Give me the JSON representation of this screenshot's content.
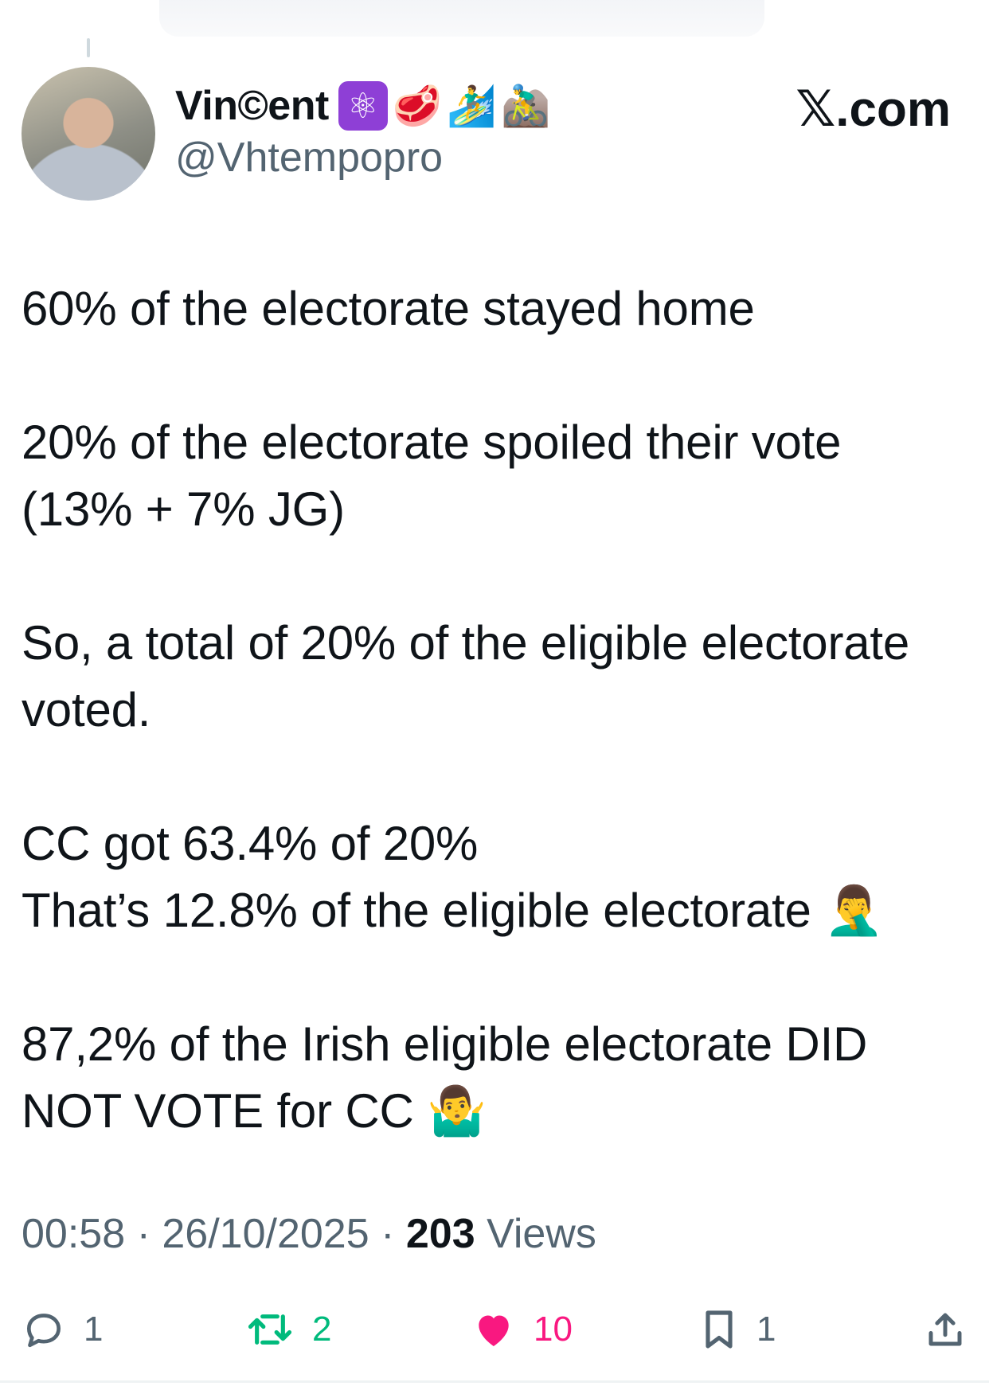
{
  "author": {
    "display_name": "Vin©ent",
    "emojis": [
      "⚛️",
      "🥩",
      "🏄‍♂️",
      "🚵‍♂️"
    ],
    "handle": "@Vhtempopro"
  },
  "brand": "𝕏.com",
  "tweet": {
    "text": "60% of the electorate stayed home\n\n20% of the electorate spoiled their vote\n(13% + 7% JG)\n\nSo, a total of 20% of the eligible electorate voted.\n\nCC got 63.4% of 20%\nThat’s 12.8% of the eligible electorate 🤦‍♂️\n\n87,2% of the Irish eligible electorate DID NOT VOTE for CC 🤷‍♂️"
  },
  "meta": {
    "time": "00:58",
    "date": "26/10/2025",
    "views_count": "203",
    "views_label": "Views",
    "separator": "·"
  },
  "actions": {
    "replies": "1",
    "retweets": "2",
    "likes": "10",
    "bookmarks": "1"
  },
  "colors": {
    "retweet": "#00ba7c",
    "like": "#f91880",
    "secondary_text": "#536471",
    "atom_bg": "#8e3fd6"
  },
  "icons": [
    "reply-icon",
    "retweet-icon",
    "like-heart-icon",
    "bookmark-icon",
    "share-icon"
  ]
}
